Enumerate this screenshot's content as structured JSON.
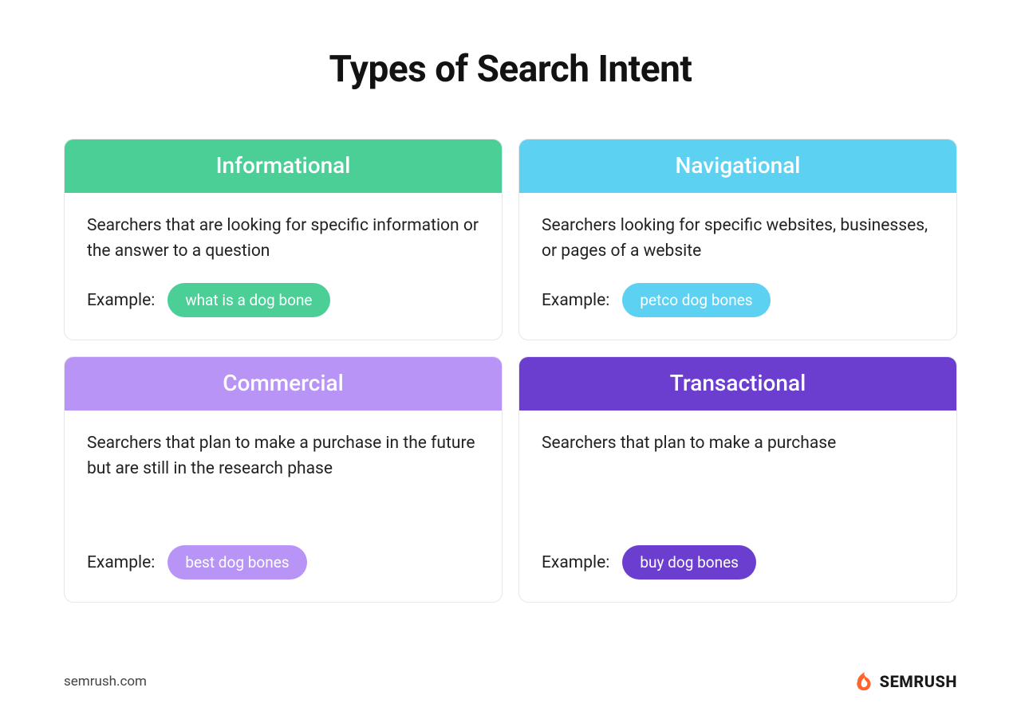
{
  "title": "Types of Search Intent",
  "cards": [
    {
      "heading": "Informational",
      "description": "Searchers that are looking for specific information or the answer to a question",
      "example_label": "Example:",
      "example_pill": "what is a dog bone",
      "header_color": "#4bcf97",
      "pill_color": "#4bcf97"
    },
    {
      "heading": "Navigational",
      "description": "Searchers looking for specific websites, businesses, or pages of a website",
      "example_label": "Example:",
      "example_pill": "petco dog bones",
      "header_color": "#5dd1f2",
      "pill_color": "#5dd1f2"
    },
    {
      "heading": "Commercial",
      "description": "Searchers that plan to make a purchase in the future but are still in the research phase",
      "example_label": "Example:",
      "example_pill": "best dog bones",
      "header_color": "#b794f6",
      "pill_color": "#b794f6"
    },
    {
      "heading": "Transactional",
      "description": "Searchers that plan to make a purchase",
      "example_label": "Example:",
      "example_pill": "buy dog bones",
      "header_color": "#6c3ecf",
      "pill_color": "#6c3ecf"
    }
  ],
  "footer": {
    "domain": "semrush.com",
    "brand": "SEMRUSH"
  }
}
